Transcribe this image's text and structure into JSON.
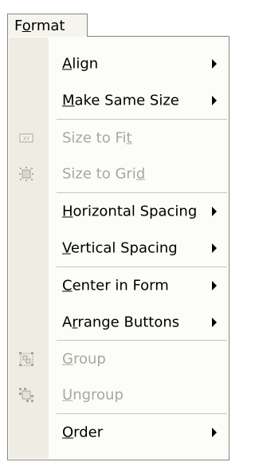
{
  "menu": {
    "title": "Format",
    "items": [
      {
        "pre": "",
        "key": "A",
        "post": "lign",
        "submenu": true,
        "enabled": true,
        "icon": ""
      },
      {
        "pre": "",
        "key": "M",
        "post": "ake Same Size",
        "submenu": true,
        "enabled": true,
        "icon": ""
      },
      {
        "pre": "Size to Fi",
        "key": "t",
        "post": "",
        "submenu": false,
        "enabled": false,
        "icon": "size-to-fit-icon"
      },
      {
        "pre": "Size to Gri",
        "key": "d",
        "post": "",
        "submenu": false,
        "enabled": false,
        "icon": "size-to-grid-icon"
      },
      {
        "pre": "",
        "key": "H",
        "post": "orizontal Spacing",
        "submenu": true,
        "enabled": true,
        "icon": ""
      },
      {
        "pre": "",
        "key": "V",
        "post": "ertical Spacing",
        "submenu": true,
        "enabled": true,
        "icon": ""
      },
      {
        "pre": "",
        "key": "C",
        "post": "enter in Form",
        "submenu": true,
        "enabled": true,
        "icon": ""
      },
      {
        "pre": "A",
        "key": "r",
        "post": "range Buttons",
        "submenu": true,
        "enabled": true,
        "icon": ""
      },
      {
        "pre": "",
        "key": "G",
        "post": "roup",
        "submenu": false,
        "enabled": false,
        "icon": "group-icon"
      },
      {
        "pre": "",
        "key": "U",
        "post": "ngroup",
        "submenu": false,
        "enabled": false,
        "icon": "ungroup-icon"
      },
      {
        "pre": "",
        "key": "O",
        "post": "rder",
        "submenu": true,
        "enabled": true,
        "icon": ""
      }
    ]
  },
  "colors": {
    "menu_background": "#fcfcf9",
    "icon_strip": "#efede3",
    "border": "#8a867a",
    "disabled_text": "#a9a79e",
    "separator": "#c9c5b8"
  }
}
